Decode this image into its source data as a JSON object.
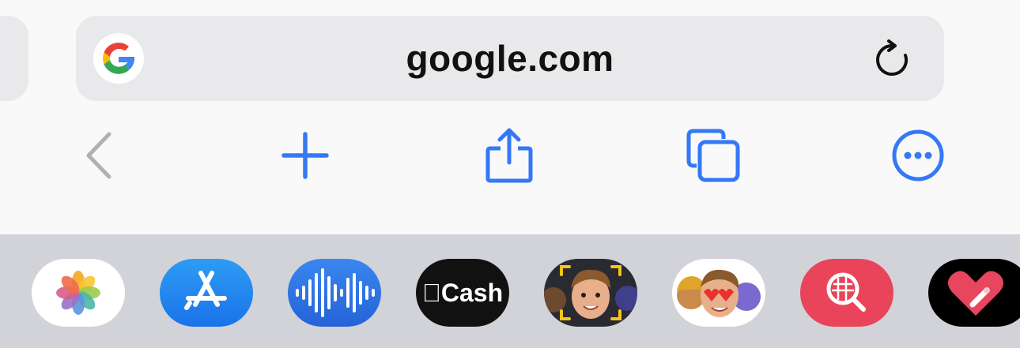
{
  "address_bar": {
    "url": "google.com",
    "site_icon": "google-g-icon",
    "reload_icon": "reload-icon"
  },
  "toolbar": {
    "buttons": [
      "back-icon",
      "new-tab-icon",
      "share-icon",
      "tabs-icon",
      "more-icon"
    ],
    "accent_color": "#3478f6",
    "disabled_color": "#b0b0b5"
  },
  "app_strip": {
    "apps": [
      {
        "name": "Photos",
        "icon": "photos-icon"
      },
      {
        "name": "App Store",
        "icon": "app-store-icon"
      },
      {
        "name": "Audio Messages",
        "icon": "waveform-icon"
      },
      {
        "name": "Apple Cash",
        "icon": "apple-cash-icon",
        "label": "Cash"
      },
      {
        "name": "Memoji",
        "icon": "memoji-camera-icon"
      },
      {
        "name": "Memoji Stickers",
        "icon": "memoji-stickers-icon"
      },
      {
        "name": "Image Search",
        "icon": "image-search-icon"
      },
      {
        "name": "Digital Touch",
        "icon": "digital-touch-icon"
      }
    ]
  }
}
